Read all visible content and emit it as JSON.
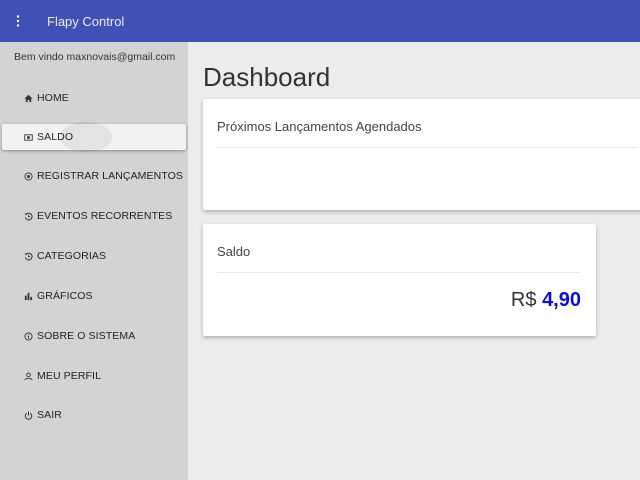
{
  "app": {
    "title": "Flapy Control"
  },
  "sidebar": {
    "welcome": "Bem vindo maxnovais@gmail.com",
    "items": [
      {
        "label": "HOME",
        "icon": "home-icon"
      },
      {
        "label": "SALDO",
        "icon": "wallet-icon",
        "active": true
      },
      {
        "label": "REGISTRAR LANÇAMENTOS",
        "icon": "add-circle-icon"
      },
      {
        "label": "EVENTOS RECORRENTES",
        "icon": "history-icon"
      },
      {
        "label": "CATEGORIAS",
        "icon": "history-icon"
      },
      {
        "label": "GRÁFICOS",
        "icon": "bar-chart-icon"
      },
      {
        "label": "SOBRE O SISTEMA",
        "icon": "info-icon"
      },
      {
        "label": "MEU PERFIL",
        "icon": "person-icon"
      },
      {
        "label": "SAIR",
        "icon": "power-icon"
      }
    ]
  },
  "main": {
    "title": "Dashboard",
    "cards": [
      {
        "title": "Próximos Lançamentos Agendados"
      },
      {
        "title": "Saldo",
        "currency": "R$",
        "amount": "4,90"
      }
    ]
  },
  "colors": {
    "topbar": "#3f51b5",
    "sidebar": "#d3d3d3",
    "amount": "#1010d0"
  }
}
